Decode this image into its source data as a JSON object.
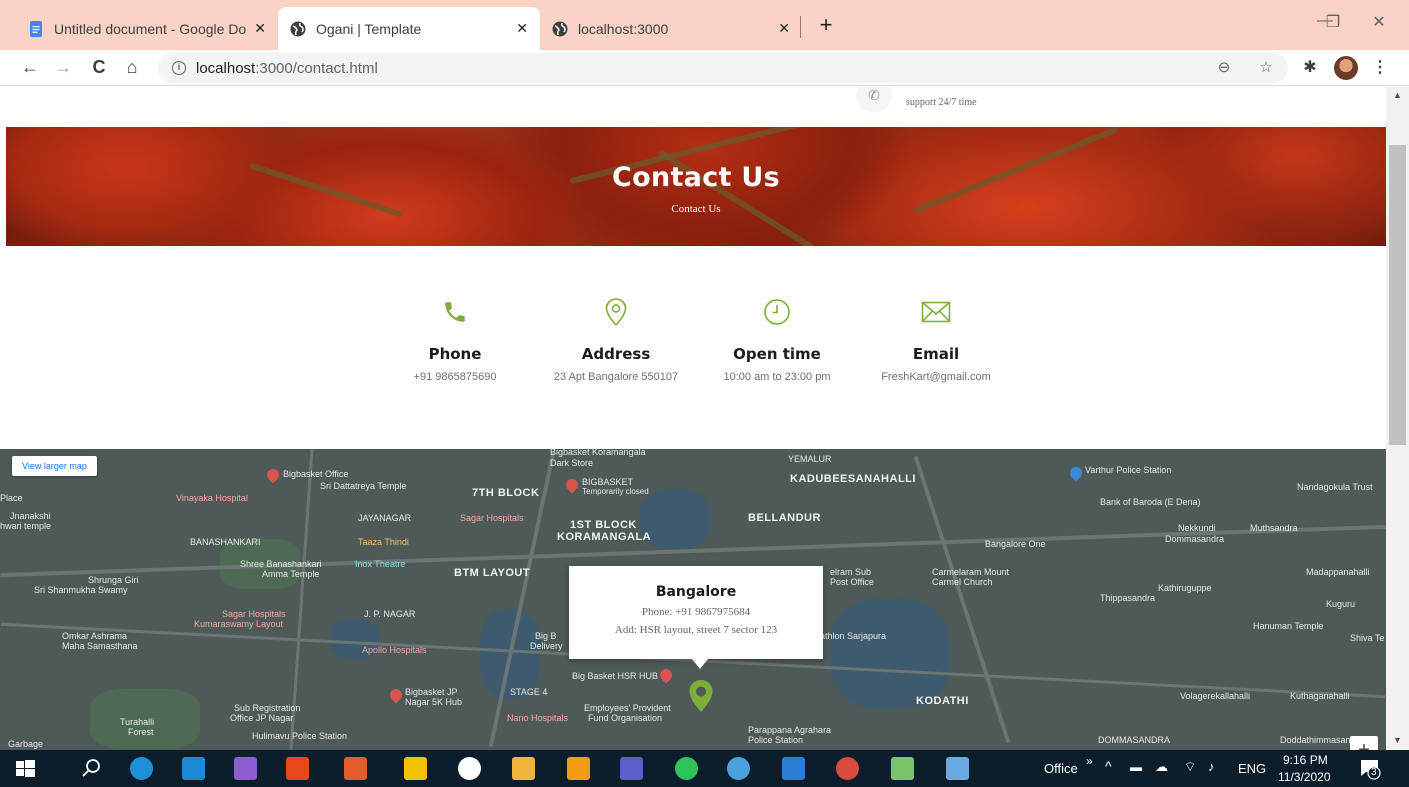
{
  "browser": {
    "tabs": [
      {
        "title": "Untitled document - Google Doc",
        "close": "✕"
      },
      {
        "title": "Ogani | Template",
        "close": "✕"
      },
      {
        "title": "localhost:3000",
        "close": "✕"
      }
    ],
    "new_tab": "+",
    "window_controls": {
      "minimize": "—",
      "restore": "❐",
      "close": "✕"
    },
    "nav": {
      "back": "←",
      "forward": "→",
      "reload": "C",
      "home": "⌂"
    },
    "url_host": "localhost",
    "url_path": ":3000/contact.html",
    "info_glyph": "i",
    "zoom_glyph": "⊖",
    "star_glyph": "☆",
    "extensions_glyph": "✱",
    "menu_glyph": "⋮"
  },
  "header_strip": {
    "support_text": "support 24/7 time",
    "phone_glyph": "✆"
  },
  "hero": {
    "title": "Contact Us",
    "breadcrumb": "Contact Us"
  },
  "contact_info": [
    {
      "icon": "phone-icon",
      "label": "Phone",
      "value": "+91 9865875690"
    },
    {
      "icon": "map-pin-icon",
      "label": "Address",
      "value": "23 Apt Bangalore 550107"
    },
    {
      "icon": "clock-icon",
      "label": "Open time",
      "value": "10:00 am to 23:00 pm"
    },
    {
      "icon": "mail-icon",
      "label": "Email",
      "value": "FreshKart@gmail.com"
    }
  ],
  "accent_color": "#7fad39",
  "map": {
    "view_larger": "View larger map",
    "zoom_in": "+",
    "popup": {
      "title": "Bangalore",
      "phone": "Phone: +91 9867975684",
      "address": "Add: HSR layout, street 7 sector 123"
    },
    "labels": {
      "koramangala_store": "Bigbasket Koramangala",
      "dark_store": "Dark Store",
      "yemalur": "YEMALUR",
      "kadubeesanahalli": "KADUBEESANAHALLI",
      "varthur_police": "Varthur Police Station",
      "bigbasket_office": "Bigbasket Office",
      "dattatreya": "Sri Dattatreya Temple",
      "bigbasket_label": "BIGBASKET",
      "temp_closed": "Temporarily closed",
      "nandagokula": "Nandagokula Trust",
      "vinayaka": "Vinayaka Hospital",
      "block7": "7TH BLOCK",
      "bellandur": "BELLANDUR",
      "bank_baroda": "Bank of Baroda (E Dena)",
      "jayanagar": "JAYANAGAR",
      "sagar_hospitals": "Sagar Hospitals",
      "block1": "1ST BLOCK",
      "koramangala": "KORAMANGALA",
      "nekkundi": "Nekkundi",
      "dommasandra": "Dommasandra",
      "muthsandra": "Muthsandra",
      "banashankari": "BANASHANKARI",
      "taaza": "Taaza Thindi",
      "bangalore_one": "Bangalore One",
      "shree_banashankari": "Shree Banashankari",
      "amma_temple": "Amma Temple",
      "inox": "Inox Theatre",
      "btm": "BTM LAYOUT",
      "carmelaram_mount": "Carmelaram Mount",
      "carmel_church": "Carmel Church",
      "madappanahalli": "Madappanahalli",
      "shrunga": "Shrunga Giri",
      "shanmukha": "Sri Shanmukha Swamy",
      "kathiruguppe": "Kathiruguppe",
      "thippasandra": "Thippasandra",
      "kuguru": "Kuguru",
      "sagar_kumara": "Sagar Hospitals",
      "kumaraswamy": "Kumaraswamy Layout",
      "jp_nagar": "J. P. NAGAR",
      "hanuman": "Hanuman Temple",
      "shiva": "Shiva Te",
      "omkar": "Omkar Ashrama",
      "maha": "Maha Samasthana",
      "apollo": "Apollo Hospitals",
      "sarjapura": "athlon Sarjapura",
      "bigbasket_hsr": "Big Basket HSR HUB",
      "bigbasket_jp": "Bigbasket JP",
      "nagar5k": "Nagar 5K Hub",
      "stage4": "STAGE 4",
      "kodathi": "KODATHI",
      "volagere": "Volagerekallahalli",
      "kuthaganahalli": "Kuthaganahalli",
      "sub_reg": "Sub Registration",
      "office_jp": "Office JP Nagar",
      "nano": "Nano Hospitals",
      "employees": "Employees' Provident",
      "fund": "Fund Organisation",
      "turahalli": "Turahalli",
      "forest": "Forest",
      "hulimavu": "Hulimavu Police Station",
      "parappana": "Parappana Agrahara",
      "police_station": "Police Station",
      "dommasandra2": "DOMMASANDRA",
      "doddathimmasandra": "Doddathimmasandra",
      "garbage": "Garbage",
      "jnanakshi": "Jnanakshi",
      "temple_left": "hwari temple",
      "place": "Place",
      "delivery": "Delivery",
      "big_b": "Big B",
      "elram": "elram Sub",
      "post_office": "Post Office"
    }
  },
  "taskbar": {
    "office": "Office",
    "chevron": "»",
    "lang": "ENG",
    "time": "9:16 PM",
    "date": "11/3/2020",
    "notif": "3"
  }
}
